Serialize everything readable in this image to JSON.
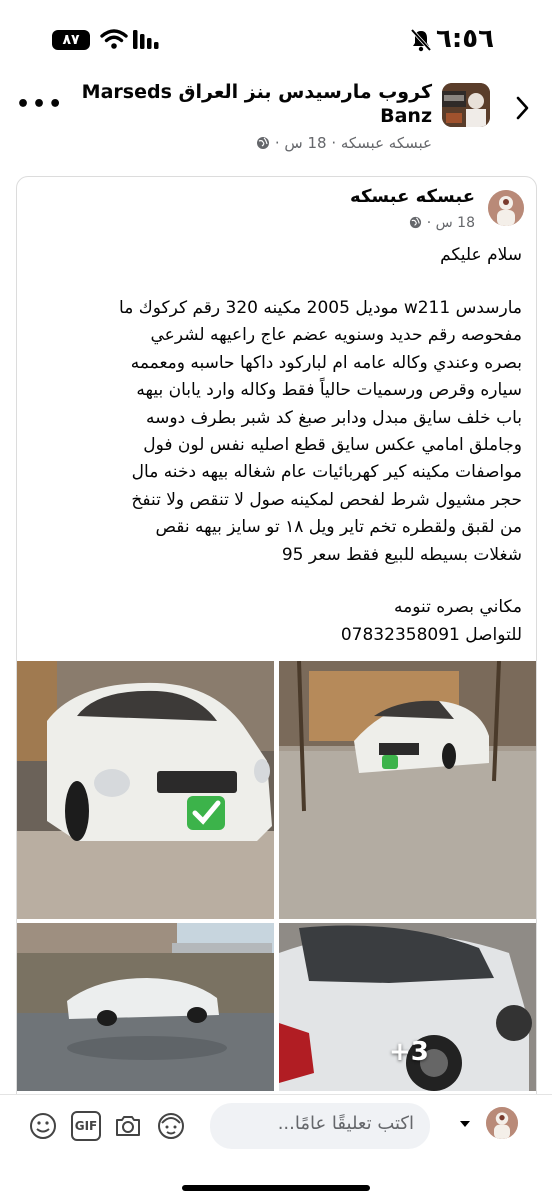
{
  "status_bar": {
    "time": "٦:٥٦",
    "battery": "٨٧"
  },
  "header": {
    "group_title": "كروب مارسيدس بنز العراق Marseds Banz",
    "subtitle": "عبسكه عبسكه · 18 س ·"
  },
  "post": {
    "author": "عبسكه عبسكه",
    "meta": "18 س ·",
    "greeting": "سلام عليكم",
    "body_lines": [
      "مارسدس w211 موديل 2005 مكينه 320 رقم كركوك ما",
      "مفحوصه رقم حديد وسنويه عضم عاج راعيهه لشرعي",
      "بصره وعندي وكاله عامه ام لباركود داكها حاسبه ومعممه",
      "سياره وقرص ورسميات حالياً فقط وكاله وارد يابان بيهه",
      "باب خلف سايق مبدل ودابر صبغ كد شبر بطرف دوسه",
      "وجاملق امامي عكس سايق قطع اصليه نفس لون فول",
      "مواصفات مكينه كير كهربائيات عام شغاله بيهه دخنه مال",
      "حجر مشيول شرط لفحص لمكينه صول لا تنقص ولا تنفخ",
      "من لقبق ولقطره تخم تاير ويل ١٨ تو سايز بيهه نقص",
      "شغلات بسيطه للبيع فقط سعر 95"
    ],
    "location": "مكاني بصره تنومه",
    "contact": "للتواصل 07832358091",
    "more_photos": "+3"
  },
  "comment_bar": {
    "placeholder": "اكتب تعليقًا عامًا...",
    "gif_label": "GIF"
  }
}
